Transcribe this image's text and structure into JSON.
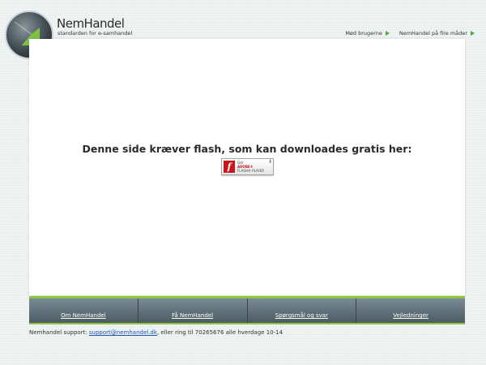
{
  "header": {
    "brand_name": "NemHandel",
    "tagline": "standarden for e-samhandel",
    "logo_icon": "arrow-sphere-icon",
    "nav": [
      {
        "label": "Mød brugerne"
      },
      {
        "label": "NemHandel på fire måder"
      }
    ]
  },
  "main": {
    "message": "Denne side kræver flash, som kan downloades gratis her:",
    "flash_button": {
      "line1": "Get",
      "line2": "ADOBE®",
      "line3": "FLASH® PLAYER",
      "icon": "flash-f-icon"
    }
  },
  "footer": {
    "links": [
      {
        "label": "Om NemHandel"
      },
      {
        "label": "Få NemHandel"
      },
      {
        "label": "Spørgsmål og svar"
      },
      {
        "label": "Vejledninger"
      }
    ],
    "support_prefix": "Nemhandel support: ",
    "support_email": "support@nemhandel.dk",
    "support_suffix": ", eller ring til 70265676 alle hverdage 10-14"
  },
  "colors": {
    "accent_green": "#8cc63f",
    "nav_triangle": "#52a83a",
    "footer_bar": "#5a6a74",
    "flash_red": "#c8161d"
  }
}
